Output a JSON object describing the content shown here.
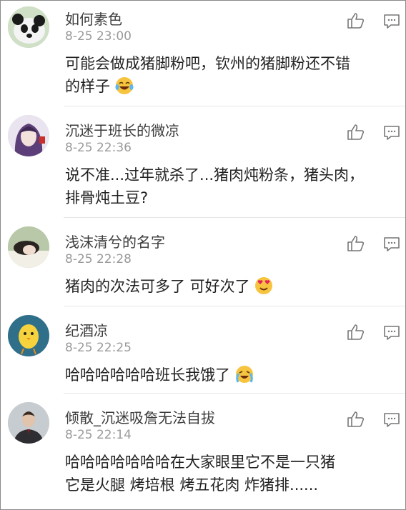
{
  "comments": [
    {
      "username": "如何素色",
      "time": "8-25 23:00",
      "lines": [
        "可能会做成猪脚粉吧，钦州的猪脚粉还不错",
        "的样子"
      ],
      "emoji": "laughing-tears-emoji",
      "avatar": "panda-avatar"
    },
    {
      "username": "沉迷于班长的微凉",
      "time": "8-25 22:36",
      "lines": [
        "说不准...过年就杀了...猪肉炖粉条，猪头肉，",
        "排骨炖土豆?"
      ],
      "avatar": "anime-girl-avatar"
    },
    {
      "username": "浅沫清兮的名字",
      "time": "8-25 22:28",
      "lines": [
        "猪肉的次法可多了 可好次了"
      ],
      "emoji": "heart-eyes-emoji",
      "avatar": "girl-lying-avatar"
    },
    {
      "username": "纪酒凉",
      "time": "8-25 22:25",
      "lines": [
        "哈哈哈哈哈哈班长我饿了"
      ],
      "emoji": "crying-laughing-emoji",
      "avatar": "yellow-chick-avatar"
    },
    {
      "username": "倾散_沉迷吸詹无法自拔",
      "time": "8-25 22:14",
      "lines": [
        "哈哈哈哈哈哈哈在大家眼里它不是一只猪",
        "它是火腿 烤培根 烤五花肉 炸猪排......"
      ],
      "avatar": "man-suit-avatar"
    }
  ],
  "icons": {
    "like": "thumbs-up-icon",
    "reply": "comment-icon"
  },
  "colors": {
    "username": "#3c3c3c",
    "time": "#9a9a9a",
    "text": "#222222",
    "divider": "#e6e6e6"
  }
}
